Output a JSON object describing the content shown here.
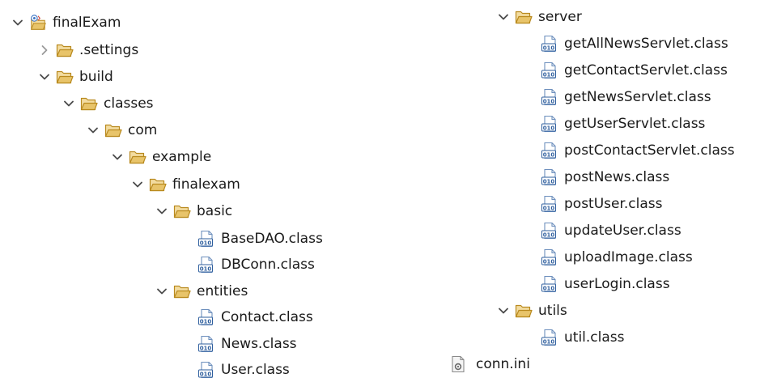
{
  "tree_left": [
    {
      "label": "finalExam",
      "icon": "project-icon",
      "chevron": "expanded"
    },
    {
      "label": ".settings",
      "icon": "folder-icon",
      "chevron": "collapsed"
    },
    {
      "label": "build",
      "icon": "folder-icon",
      "chevron": "expanded"
    },
    {
      "label": "classes",
      "icon": "folder-icon",
      "chevron": "expanded"
    },
    {
      "label": "com",
      "icon": "folder-icon",
      "chevron": "expanded"
    },
    {
      "label": "example",
      "icon": "folder-icon",
      "chevron": "expanded"
    },
    {
      "label": "finalexam",
      "icon": "folder-icon",
      "chevron": "expanded"
    },
    {
      "label": "basic",
      "icon": "folder-icon",
      "chevron": "expanded"
    },
    {
      "label": "BaseDAO.class",
      "icon": "class-file-icon",
      "chevron": "none"
    },
    {
      "label": "DBConn.class",
      "icon": "class-file-icon",
      "chevron": "none"
    },
    {
      "label": "entities",
      "icon": "folder-icon",
      "chevron": "expanded"
    },
    {
      "label": "Contact.class",
      "icon": "class-file-icon",
      "chevron": "none"
    },
    {
      "label": "News.class",
      "icon": "class-file-icon",
      "chevron": "none"
    },
    {
      "label": "User.class",
      "icon": "class-file-icon",
      "chevron": "none"
    }
  ],
  "tree_right": [
    {
      "label": "server",
      "icon": "folder-icon",
      "chevron": "expanded"
    },
    {
      "label": "getAllNewsServlet.class",
      "icon": "class-file-icon",
      "chevron": "none"
    },
    {
      "label": "getContactServlet.class",
      "icon": "class-file-icon",
      "chevron": "none"
    },
    {
      "label": "getNewsServlet.class",
      "icon": "class-file-icon",
      "chevron": "none"
    },
    {
      "label": "getUserServlet.class",
      "icon": "class-file-icon",
      "chevron": "none"
    },
    {
      "label": "postContactServlet.class",
      "icon": "class-file-icon",
      "chevron": "none"
    },
    {
      "label": "postNews.class",
      "icon": "class-file-icon",
      "chevron": "none"
    },
    {
      "label": "postUser.class",
      "icon": "class-file-icon",
      "chevron": "none"
    },
    {
      "label": "updateUser.class",
      "icon": "class-file-icon",
      "chevron": "none"
    },
    {
      "label": "uploadImage.class",
      "icon": "class-file-icon",
      "chevron": "none"
    },
    {
      "label": "userLogin.class",
      "icon": "class-file-icon",
      "chevron": "none"
    },
    {
      "label": "utils",
      "icon": "folder-icon",
      "chevron": "expanded"
    },
    {
      "label": "util.class",
      "icon": "class-file-icon",
      "chevron": "none"
    },
    {
      "label": "conn.ini",
      "icon": "settings-file-icon",
      "chevron": "none"
    }
  ],
  "colors": {
    "folder": "#e8c46a",
    "folder_edge": "#b98a1f",
    "class_blue": "#2f5f9e",
    "chevron": "#4a4a4a"
  }
}
